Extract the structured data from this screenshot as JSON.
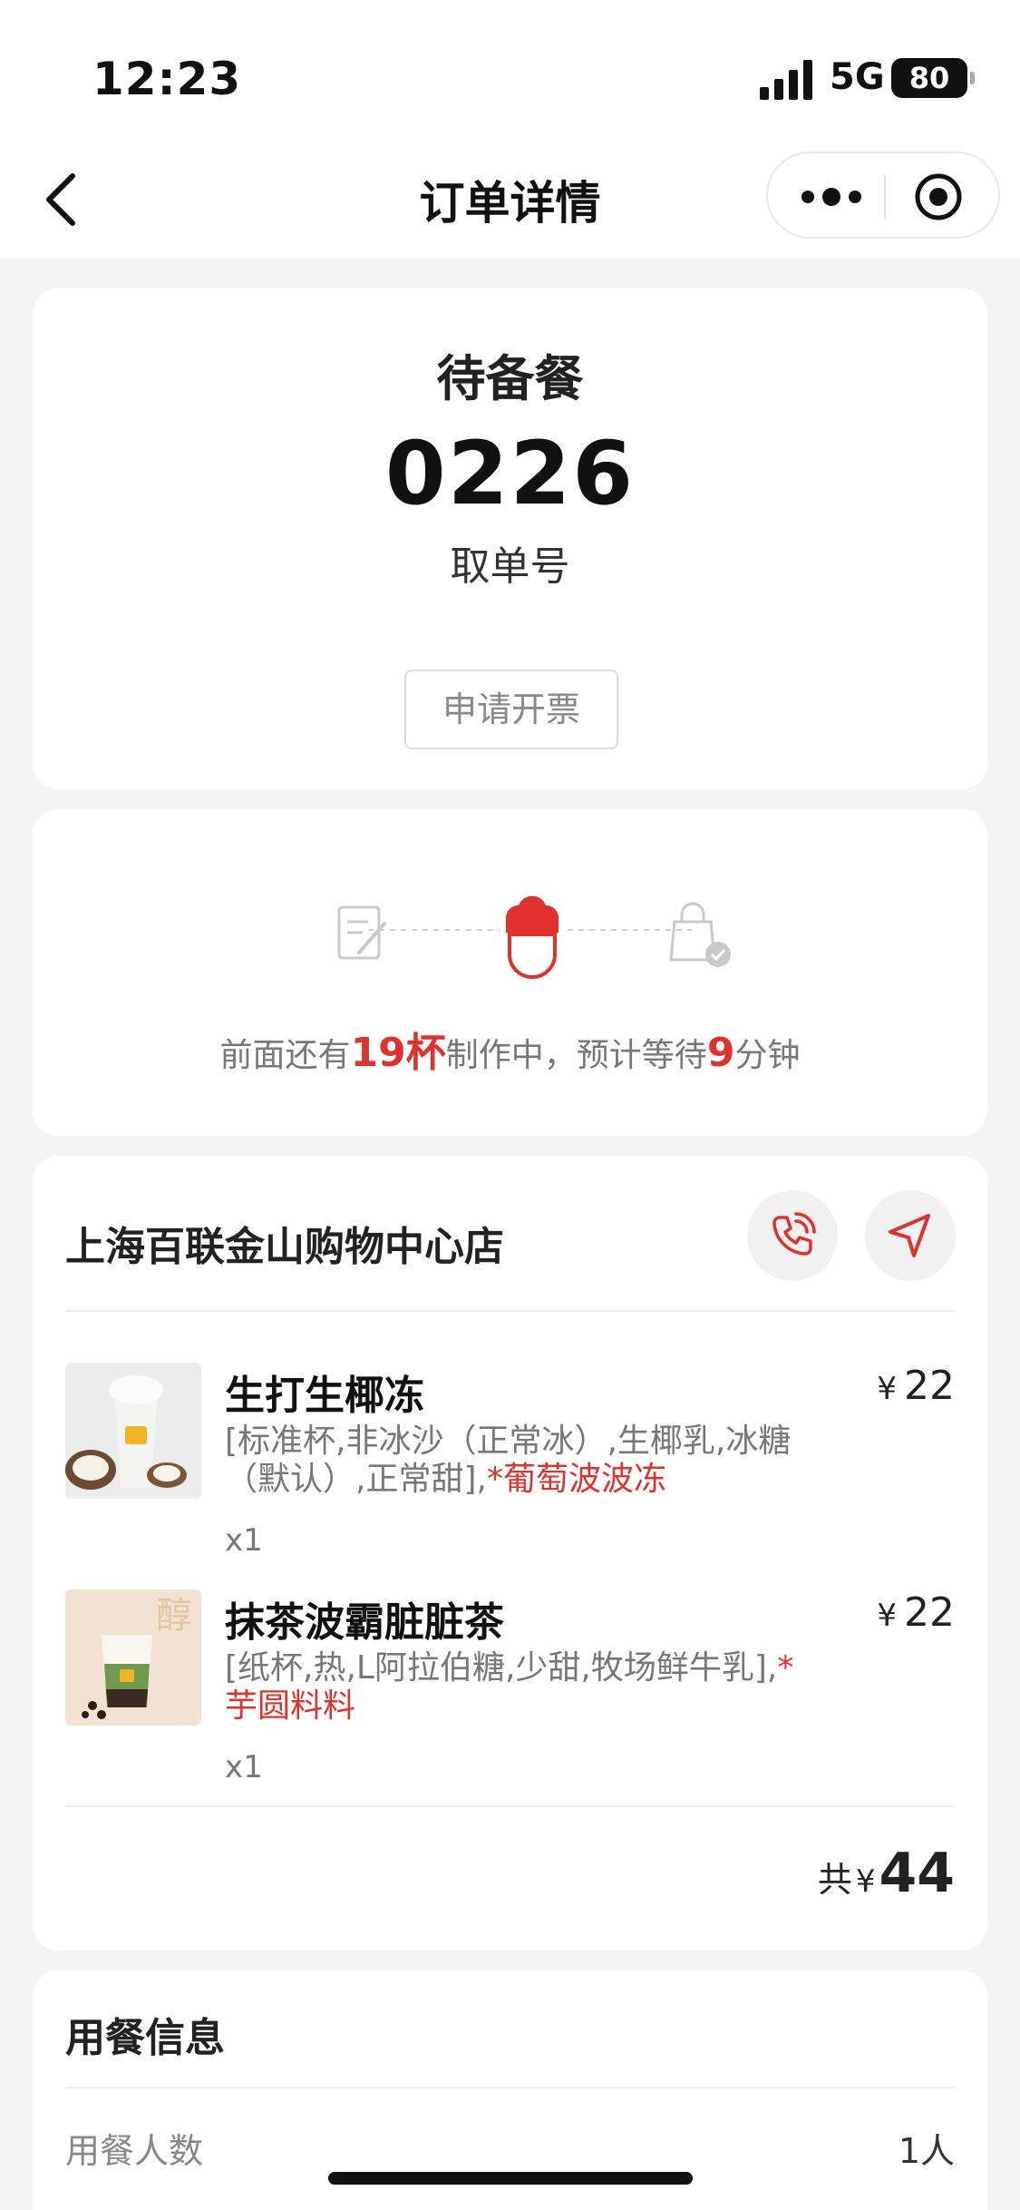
{
  "status_bar": {
    "time": "12:23",
    "network": "5G",
    "battery": "80"
  },
  "nav": {
    "title": "订单详情"
  },
  "order_status": {
    "status": "待备餐",
    "pickup_number": "0226",
    "pickup_label": "取单号",
    "invoice_button": "申请开票"
  },
  "progress": {
    "prefix": "前面还有",
    "cups": "19杯",
    "middle": "制作中，预计等待",
    "minutes": "9",
    "suffix": "分钟",
    "active_step": 2
  },
  "store": {
    "name": "上海百联金山购物中心店",
    "items": [
      {
        "name": "生打生椰冻",
        "spec": "[标准杯,非冰沙（正常冰）,生椰乳,冰糖（默认）,正常甜],",
        "extra": "*葡萄波波冻",
        "qty": "x1",
        "currency": "¥",
        "price": "22"
      },
      {
        "name": "抹茶波霸脏脏茶",
        "spec": "[纸杯,热,L阿拉伯糖,少甜,牧场鲜牛乳],",
        "extra": "*芋圆料料",
        "qty": "x1",
        "currency": "¥",
        "price": "22"
      }
    ],
    "total_prefix": "共",
    "total_currency": "¥",
    "total": "44"
  },
  "dining_info": {
    "title": "用餐信息",
    "people_label": "用餐人数",
    "people_value": "1人"
  },
  "colors": {
    "accent": "#e0312d",
    "background": "#f4f4f4"
  }
}
